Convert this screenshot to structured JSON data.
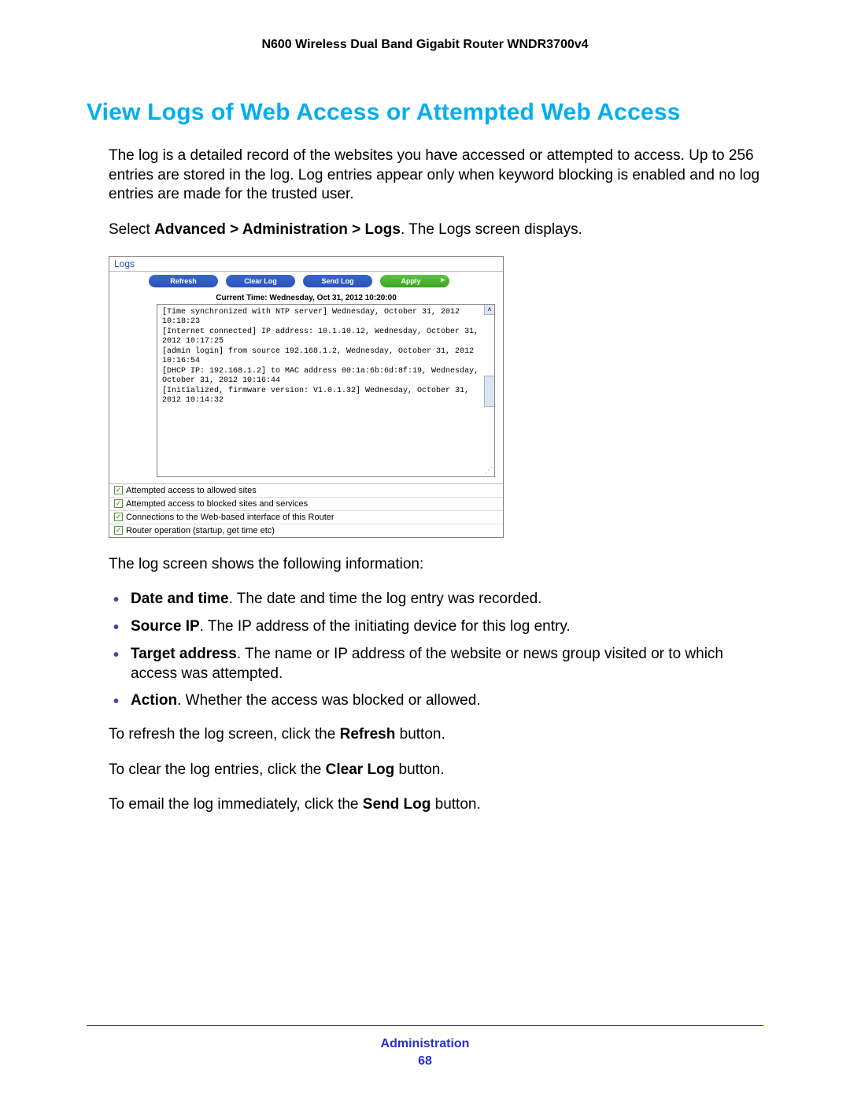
{
  "header": {
    "product": "N600 Wireless Dual Band Gigabit Router WNDR3700v4"
  },
  "title": "View Logs of Web Access or Attempted Web Access",
  "intro": "The log is a detailed record of the websites you have accessed or attempted to access. Up to 256 entries are stored in the log. Log entries appear only when keyword blocking is enabled and no log entries are made for the trusted user.",
  "nav_instruction_pre": "Select ",
  "nav_instruction_bold": "Advanced > Administration > Logs",
  "nav_instruction_post": ". The Logs screen displays.",
  "screenshot": {
    "tab_label": "Logs",
    "buttons": {
      "refresh": "Refresh",
      "clear": "Clear Log",
      "send": "Send Log",
      "apply": "Apply"
    },
    "current_time": "Current Time: Wednesday, Oct 31, 2012 10:20:00",
    "log_lines": "[Time synchronized with NTP server] Wednesday, October 31, 2012 10:18:23\n[Internet connected] IP address: 10.1.10.12, Wednesday, October 31, 2012 10:17:25\n[admin login] from source 192.168.1.2, Wednesday, October 31, 2012 10:16:54\n[DHCP IP: 192.168.1.2] to MAC address 00:1a:6b:6d:8f:19, Wednesday, October 31, 2012 10:16:44\n[Initialized, firmware version: V1.0.1.32] Wednesday, October 31, 2012 10:14:32",
    "options": [
      "Attempted access to allowed sites",
      "Attempted access to blocked sites and services",
      "Connections to the Web-based interface of this Router",
      "Router operation (startup, get time etc)"
    ]
  },
  "after_shot": "The log screen shows the following information:",
  "bullets": [
    {
      "bold": "Date and time",
      "text": ". The date and time the log entry was recorded."
    },
    {
      "bold": "Source IP",
      "text": ". The IP address of the initiating device for this log entry."
    },
    {
      "bold": "Target address",
      "text": ". The name or IP address of the website or news group visited or to which access was attempted."
    },
    {
      "bold": "Action",
      "text": ". Whether the access was blocked or allowed."
    }
  ],
  "instructions": [
    {
      "pre": "To refresh the log screen, click the ",
      "bold": "Refresh",
      "post": " button."
    },
    {
      "pre": "To clear the log entries, click the ",
      "bold": "Clear Log",
      "post": " button."
    },
    {
      "pre": "To email the log immediately, click the ",
      "bold": "Send Log",
      "post": " button."
    }
  ],
  "footer": {
    "section": "Administration",
    "page": "68"
  }
}
